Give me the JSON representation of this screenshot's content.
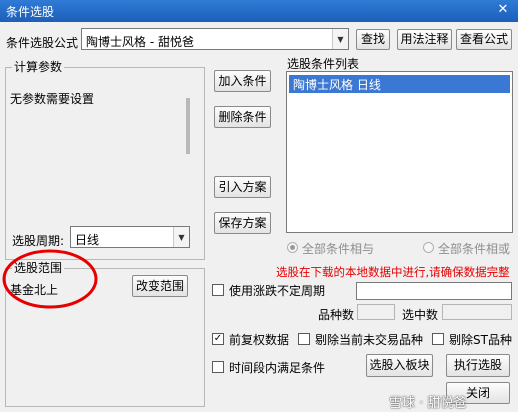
{
  "window": {
    "title": "条件选股",
    "close_glyph": "✕"
  },
  "formula": {
    "label": "条件选股公式",
    "value": "陶博士风格 - 甜悦爸",
    "buttons": {
      "find": "查找",
      "usage": "用法注释",
      "view": "查看公式"
    }
  },
  "params": {
    "legend": "计算参数",
    "empty_text": "无参数需要设置",
    "period_label": "选股周期:",
    "period_value": "日线"
  },
  "scope": {
    "legend": "选股范围",
    "value": "基金北上",
    "change_button": "改变范围"
  },
  "middle_buttons": {
    "add": "加入条件",
    "delete": "删除条件",
    "import": "引入方案",
    "save": "保存方案"
  },
  "conditions": {
    "legend": "选股条件列表",
    "items": [
      "陶博士风格  日线"
    ]
  },
  "logic": {
    "and_label": "全部条件相与",
    "or_label": "全部条件相或"
  },
  "warning": "选股在下载的本地数据中进行,请确保数据完整",
  "options": {
    "variable_period": "使用涨跌不定周期",
    "stock_count_label": "品种数",
    "selected_count_label": "选中数",
    "pre_adjusted": "前复权数据",
    "exclude_untraded": "剔除当前未交易品种",
    "exclude_st": "剔除ST品种",
    "time_range": "时间段内满足条件",
    "pre_adjusted_checked": true,
    "variable_period_checked": false,
    "exclude_untraded_checked": false,
    "exclude_st_checked": false,
    "time_range_checked": false
  },
  "actions": {
    "to_block": "选股入板块",
    "run": "执行选股",
    "close": "关闭"
  },
  "watermark": "雪球 · 甜悦爸",
  "annotation": {
    "color": "#e60000"
  }
}
